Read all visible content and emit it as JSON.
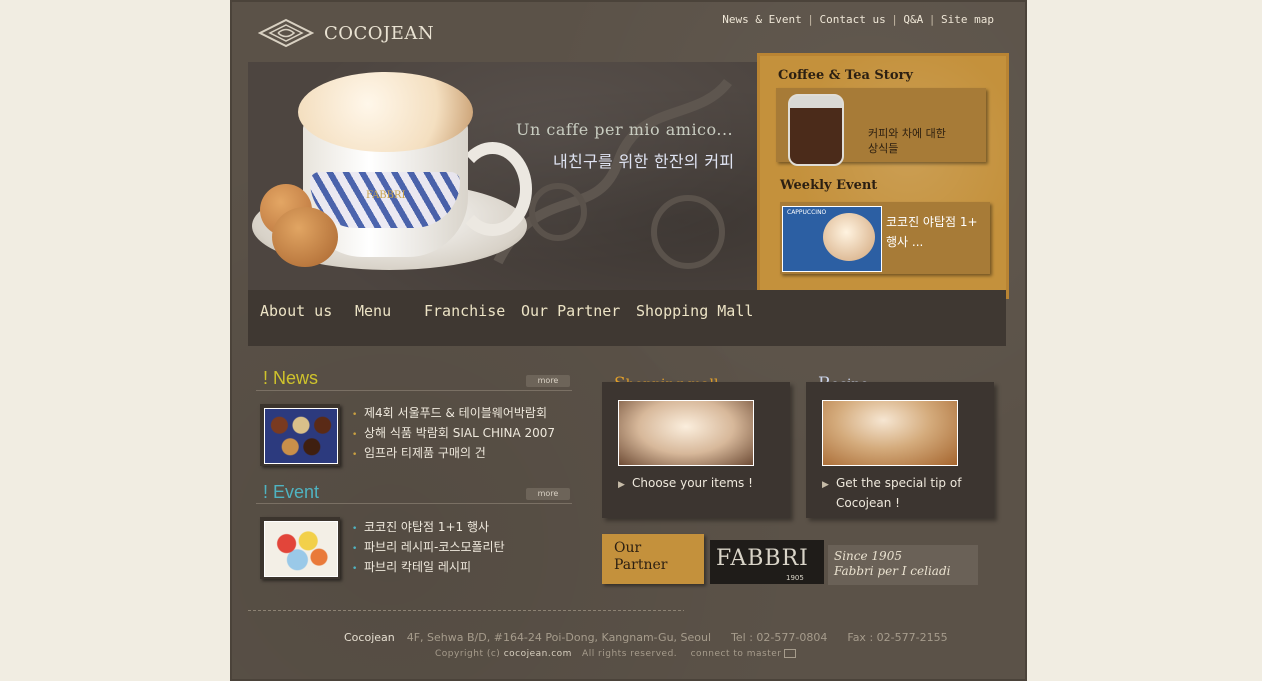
{
  "header": {
    "logo_text": "COCOJEAN",
    "top_links": [
      "News & Event",
      "Contact us",
      "Q&A",
      "Site map"
    ]
  },
  "hero": {
    "slogan_en": "Un caffe per mio amico...",
    "slogan_ko": "내친구를 위한 한잔의 커피",
    "cup_label": "FABBRI"
  },
  "side": {
    "story_title": "Coffee & Tea Story",
    "story_text_1": "커피와 차에 대한",
    "story_text_2": "상식들",
    "event_title": "Weekly Event",
    "event_text_1": "코코진 야탑점 1+",
    "event_text_2": "행사 ...",
    "event_thumb_label": "CAPPUCCINO"
  },
  "mainnav": [
    "About us",
    "Menu",
    "Franchise",
    "Our Partner",
    "Shopping Mall"
  ],
  "news": {
    "title": "! News",
    "more": "more",
    "items": [
      "제4회 서울푸드 & 테이블웨어박람회",
      "상해 식품 박람회 SIAL CHINA 2007",
      "임프라 티제품 구매의 건"
    ]
  },
  "event": {
    "title": "! Event",
    "more": "more",
    "items": [
      "코코진 야탑점 1+1 행사",
      "파브리 레시피-코스모폴리탄",
      "파브리 칵테일 레시피"
    ]
  },
  "shopping": {
    "title_first": "S",
    "title_rest": "hopping mall",
    "text": "Choose your items !"
  },
  "recipe": {
    "title_first": "R",
    "title_rest": "ecipe",
    "text_1": "Get the special tip of",
    "text_2": "Cocojean !"
  },
  "partner": {
    "tag_1": "Our",
    "tag_2": "Partner",
    "brand": "FABBRI",
    "brand_year": "1905",
    "since_1": "Since 1905",
    "since_2": "Fabbri per I celiadi"
  },
  "footer": {
    "brand": "Cocojean",
    "address": "4F, Sehwa B/D, #164-24 Poi-Dong, Kangnam-Gu, Seoul",
    "tel": "Tel : 02-577-0804",
    "fax": "Fax : 02-577-2155",
    "copyright": "Copyright (c)",
    "domain": "cocojean.com",
    "rights": "All rights reserved.",
    "connect": "connect to master"
  },
  "colors": {
    "background": "#5b5248",
    "page_bg": "#f1ede2",
    "gold_panel": "#c4913c",
    "news_title": "#cfc32c",
    "event_title": "#4fb3c1",
    "shopping_title": "#e4a12a",
    "recipe_title": "#c9d2e8"
  }
}
